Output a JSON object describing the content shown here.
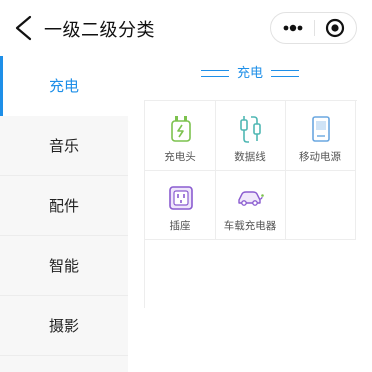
{
  "nav": {
    "title": "一级二级分类"
  },
  "sidebar": {
    "items": [
      {
        "label": "充电",
        "active": true
      },
      {
        "label": "音乐"
      },
      {
        "label": "配件"
      },
      {
        "label": "智能"
      },
      {
        "label": "摄影"
      }
    ]
  },
  "section": {
    "title": "充电",
    "items": [
      {
        "label": "充电头",
        "icon": "charger-head-icon"
      },
      {
        "label": "数据线",
        "icon": "data-cable-icon"
      },
      {
        "label": "移动电源",
        "icon": "power-bank-icon"
      },
      {
        "label": "插座",
        "icon": "socket-icon"
      },
      {
        "label": "车载充电器",
        "icon": "car-charger-icon"
      }
    ]
  },
  "colors": {
    "accent": "#1e8fe8",
    "icon_green": "#7cc24e",
    "icon_teal": "#4fb7b3",
    "icon_blue": "#6aa7e0",
    "icon_purple": "#8a5cd0"
  }
}
